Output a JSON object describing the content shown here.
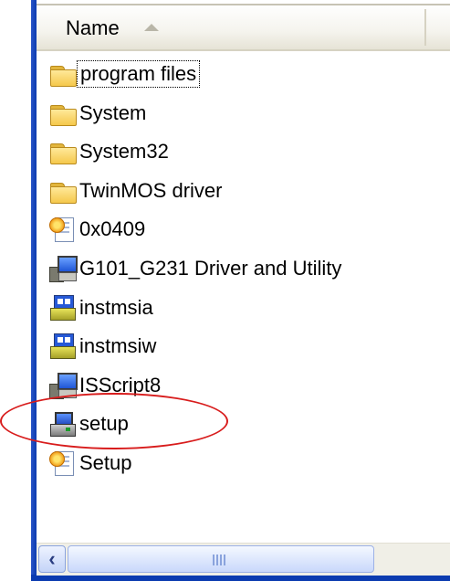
{
  "header": {
    "name_column": "Name"
  },
  "files": [
    {
      "name": "program files",
      "type": "folder",
      "icon": "folder-icon"
    },
    {
      "name": "System",
      "type": "folder",
      "icon": "folder-icon"
    },
    {
      "name": "System32",
      "type": "folder",
      "icon": "folder-icon"
    },
    {
      "name": "TwinMOS driver",
      "type": "folder",
      "icon": "folder-icon"
    },
    {
      "name": "0x0409",
      "type": "setup-info",
      "icon": "setup-info-icon"
    },
    {
      "name": "G101_G231 Driver and Utility",
      "type": "installer",
      "icon": "installer-icon"
    },
    {
      "name": "instmsia",
      "type": "msi",
      "icon": "msi-package-icon"
    },
    {
      "name": "instmsiw",
      "type": "msi",
      "icon": "msi-package-icon"
    },
    {
      "name": "ISScript8",
      "type": "installer",
      "icon": "installer-icon"
    },
    {
      "name": "setup",
      "type": "setup-app",
      "icon": "setup-application-icon"
    },
    {
      "name": "Setup",
      "type": "setup-info",
      "icon": "setup-info-icon"
    }
  ],
  "colors": {
    "frame": "#0b3bb0",
    "annotation": "#d81c1c"
  }
}
